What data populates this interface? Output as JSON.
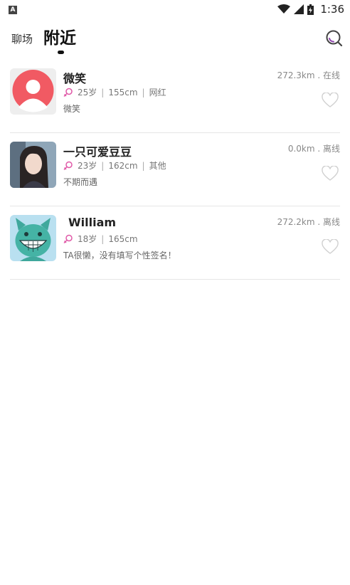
{
  "status_bar": {
    "left_icon": "A",
    "time": "1:36",
    "icons": [
      "wifi-icon",
      "signal-icon",
      "battery-icon"
    ]
  },
  "nav": {
    "tabs": [
      {
        "label": "聊场",
        "active": false
      },
      {
        "label": "附近",
        "active": true
      }
    ],
    "search_icon": "search-icon"
  },
  "users": [
    {
      "name": "微笑",
      "age": "25岁",
      "height": "155cm",
      "job": "网红",
      "signature": "微笑",
      "distance": "272.3km . 在线",
      "avatar": "default-avatar"
    },
    {
      "name": "一只可爱豆豆",
      "age": "23岁",
      "height": "162cm",
      "job": "其他",
      "signature": "不期而遇",
      "distance": "0.0km . 离线",
      "avatar": "photo-avatar"
    },
    {
      "name": "William",
      "age": "18岁",
      "height": "165cm",
      "job": "",
      "signature": "TA很懒，没有填写个性签名！",
      "distance": "272.2km . 离线",
      "avatar": "cartoon-cat-avatar"
    }
  ],
  "colors": {
    "accent_purple": "#8e44ad",
    "gender_female": "#e05aa8",
    "default_avatar_red": "#f15a63"
  }
}
